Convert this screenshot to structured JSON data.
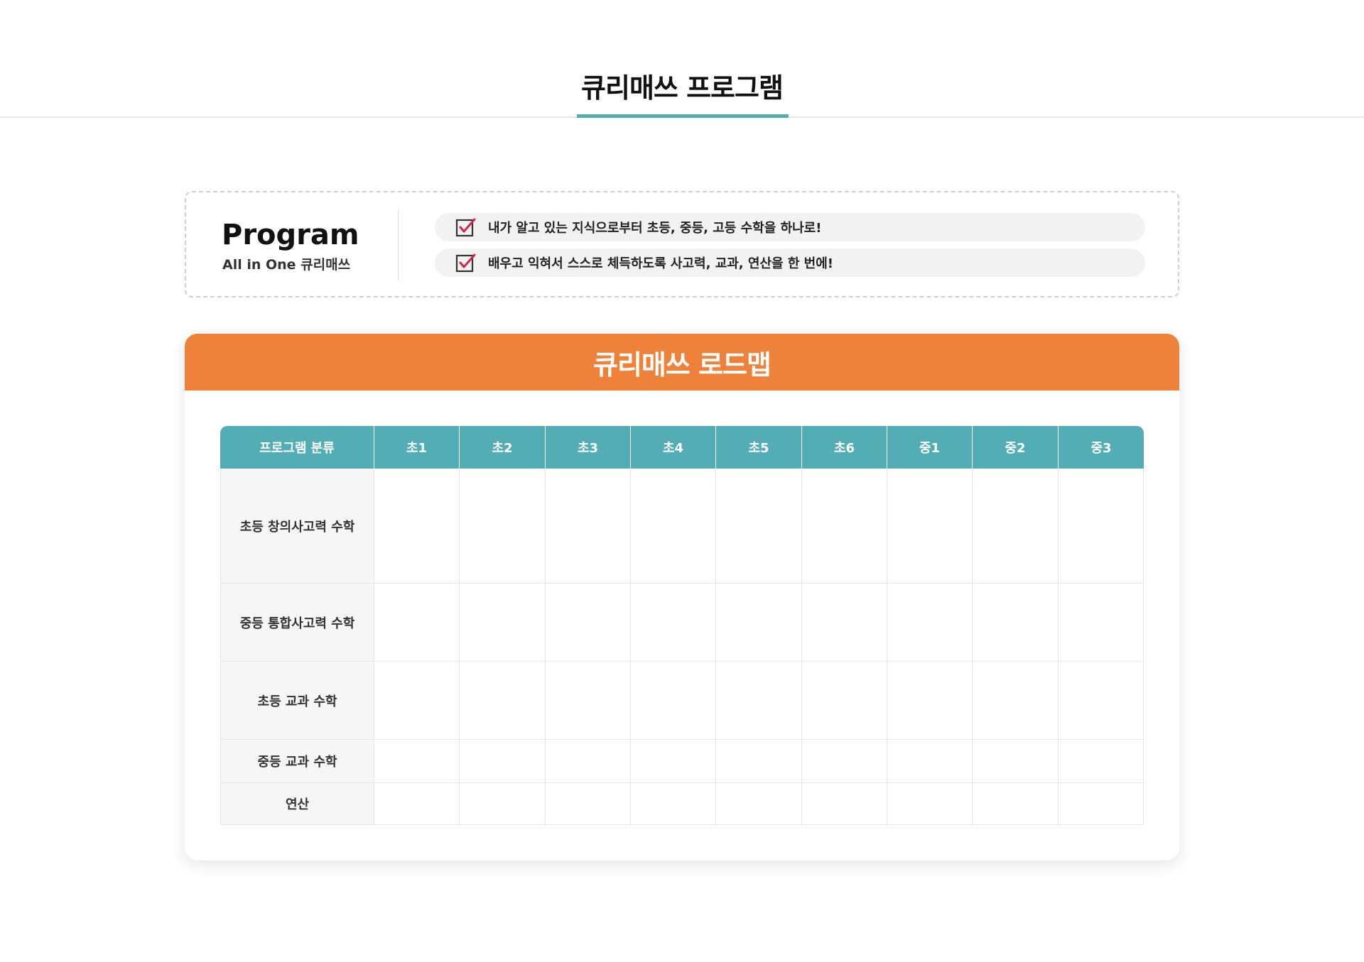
{
  "page": {
    "title": "큐리매쓰 프로그램",
    "accent_color": "#52aeb4"
  },
  "program": {
    "heading": "Program",
    "subheading": "All in One 큐리매쓰",
    "features": [
      {
        "icon": "checkbox-checked-icon",
        "text": "내가 알고 있는 지식으로부터 초등, 중등, 고등 수학을 하나로!"
      },
      {
        "icon": "checkbox-checked-icon",
        "text": "배우고 익혀서 스스로 체득하도록 사고력, 교과, 연산을 한 번에!"
      }
    ],
    "check_color": "#d6254b"
  },
  "roadmap": {
    "title": "큐리매쓰 로드맵",
    "header_color": "#ee823b",
    "table_header_color": "#52aeb4",
    "columns": [
      "프로그램 분류",
      "초1",
      "초2",
      "초3",
      "초4",
      "초5",
      "초6",
      "중1",
      "중2",
      "중3"
    ],
    "rows": [
      {
        "label": "초등 창의사고력 수학"
      },
      {
        "label": "중등 통합사고력 수학"
      },
      {
        "label": "초등 교과 수학"
      },
      {
        "label": "중등 교과 수학"
      },
      {
        "label": "연산"
      }
    ]
  }
}
